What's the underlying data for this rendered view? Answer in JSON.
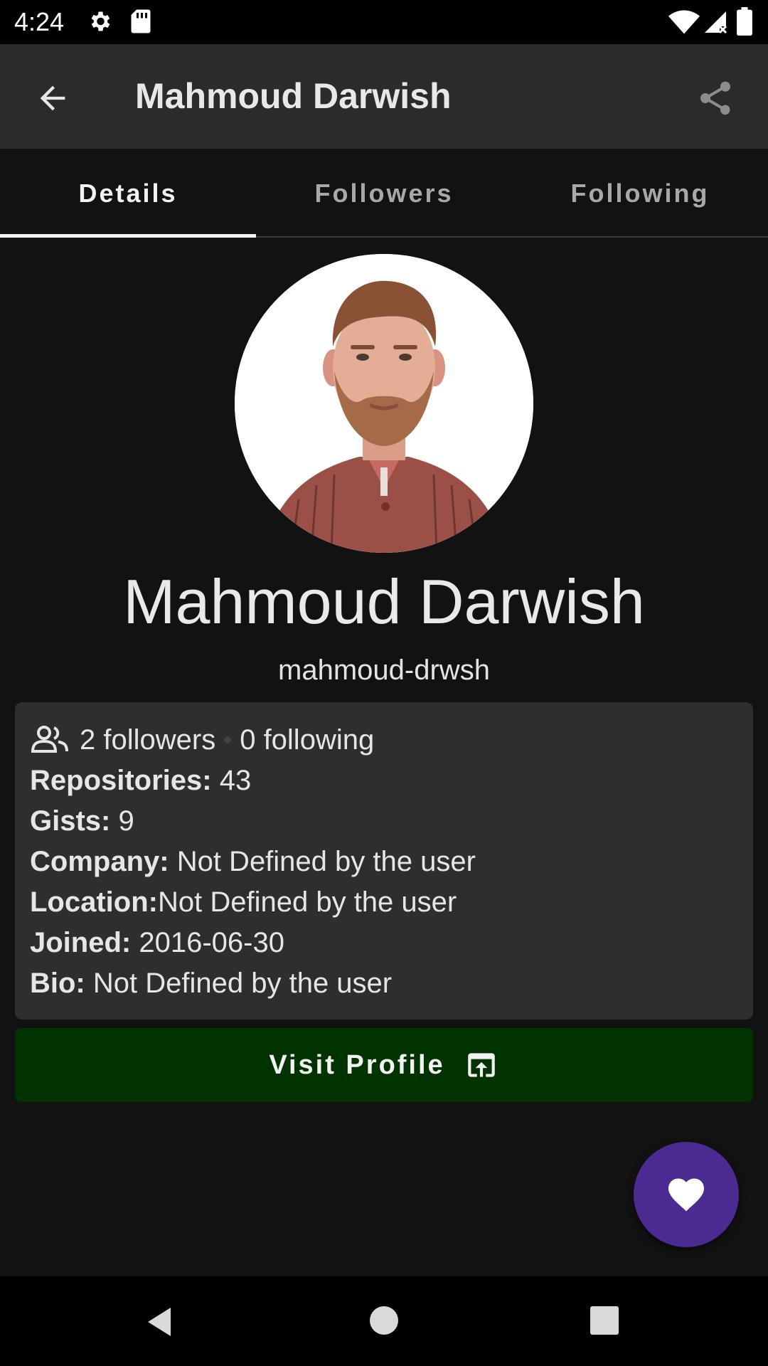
{
  "status_bar": {
    "time": "4:24"
  },
  "app_bar": {
    "title": "Mahmoud Darwish"
  },
  "tabs": [
    {
      "label": "Details",
      "active": true
    },
    {
      "label": "Followers",
      "active": false
    },
    {
      "label": "Following",
      "active": false
    }
  ],
  "profile": {
    "display_name": "Mahmoud Darwish",
    "username": "mahmoud-drwsh"
  },
  "stats": {
    "followers": "2 followers",
    "following": "0 following",
    "repositories_label": "Repositories:",
    "repositories_value": " 43",
    "gists_label": "Gists:",
    "gists_value": " 9",
    "company_label": "Company:",
    "company_value": " Not Defined by the user",
    "location_label": "Location:",
    "location_value": "Not Defined by the user",
    "joined_label": "Joined:",
    "joined_value": " 2016-06-30",
    "bio_label": "Bio:",
    "bio_value": " Not Defined by the user"
  },
  "visit_button": {
    "label": "Visit Profile"
  },
  "colors": {
    "app_bar": "#2b2b2b",
    "background": "#121212",
    "card": "#2e2e2e",
    "visit_button": "#003300",
    "fab": "#4b2a92"
  },
  "icons": {
    "back": "arrow-back-icon",
    "share": "share-icon",
    "people": "people-icon",
    "open": "open-in-browser-icon",
    "favorite": "heart-icon"
  }
}
